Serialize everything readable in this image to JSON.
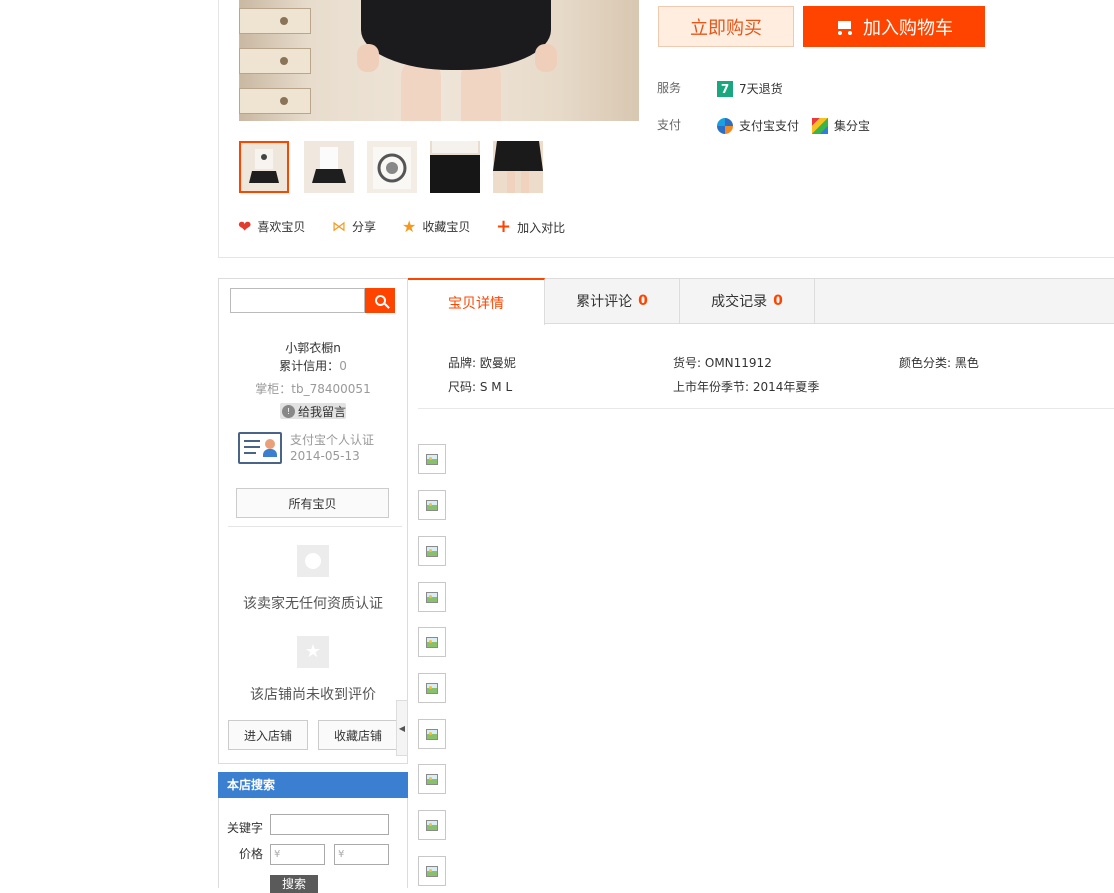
{
  "product": {
    "buy_now": "立即购买",
    "add_to_cart": "加入购物车",
    "service_label": "服务",
    "service_item": "7天退货",
    "service_badge": "7",
    "payment_label": "支付",
    "payments": [
      "支付宝支付",
      "集分宝"
    ],
    "actions": [
      "喜欢宝贝",
      "分享",
      "收藏宝贝",
      "加入对比"
    ],
    "thumbnails_count": 5,
    "selected_thumbnail": 0
  },
  "seller": {
    "search_placeholder": "",
    "shop_name": "小郭衣橱n",
    "credit_label": "累计信用：",
    "credit_value": "0",
    "wangwang": "掌柜：tb_78400051",
    "message_button": "给我留言",
    "cert_title": "支付宝个人认证",
    "cert_date": "2014-05-13",
    "all_items": "所有宝贝",
    "no_qualification": "该卖家无任何资质认证",
    "no_reviews": "该店铺尚未收到评价",
    "enter_shop": "进入店铺",
    "favorite_shop": "收藏店铺"
  },
  "store_search": {
    "title": "本店搜索",
    "keyword_label": "关键字",
    "price_label": "价格",
    "price_min_placeholder": "¥",
    "price_max_placeholder": "¥",
    "submit": "搜索"
  },
  "tabs": [
    {
      "label": "宝贝详情",
      "count": ""
    },
    {
      "label": "累计评论",
      "count": "0"
    },
    {
      "label": "成交记录",
      "count": "0"
    }
  ],
  "attributes": [
    {
      "key": "品牌",
      "value": "欧曼妮"
    },
    {
      "key": "货号",
      "value": "OMN11912"
    },
    {
      "key": "颜色分类",
      "value": "黑色"
    },
    {
      "key": "尺码",
      "value": "S M L"
    },
    {
      "key": "上市年份季节",
      "value": "2014年夏季"
    }
  ],
  "attribute_sep": ": ",
  "colors": {
    "accent": "#ff4400",
    "store_search_header": "#3a7fd0",
    "buy_now_bg": "#ffeee0"
  }
}
